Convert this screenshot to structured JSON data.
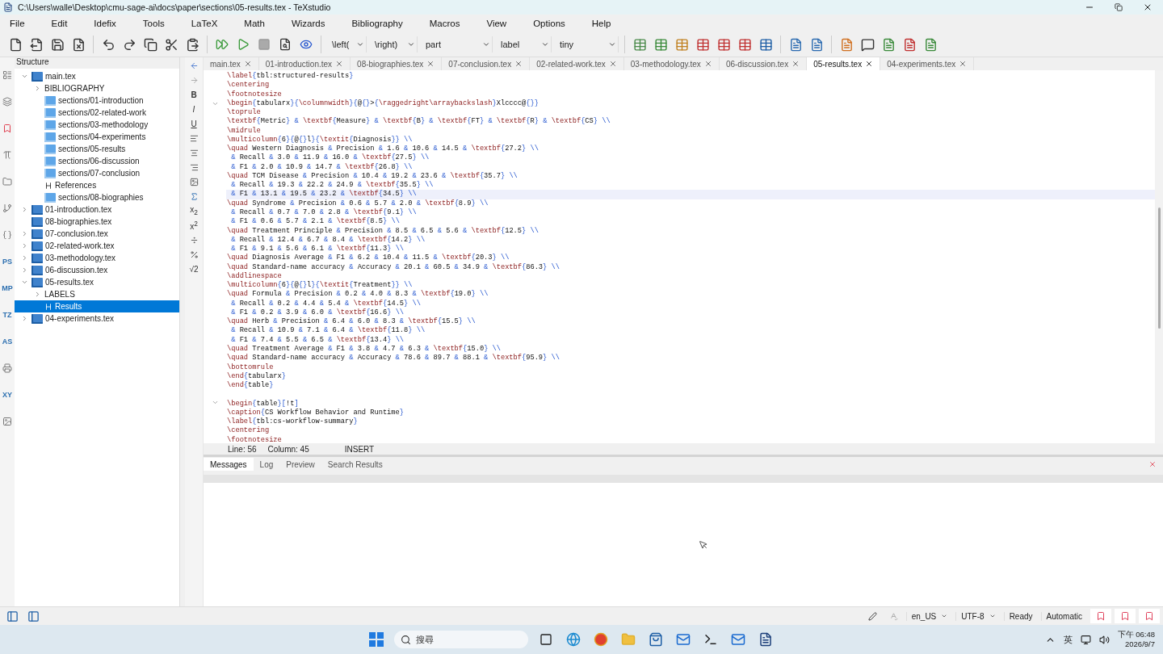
{
  "window": {
    "title": "C:\\Users\\walle\\Desktop\\cmu-sage-ai\\docs\\paper\\sections\\05-results.tex - TeXstudio"
  },
  "menu": [
    "File",
    "Edit",
    "Idefix",
    "Tools",
    "LaTeX",
    "Math",
    "Wizards",
    "Bibliography",
    "Macros",
    "View",
    "Options",
    "Help"
  ],
  "toolbar_combos": [
    {
      "value": "\\left("
    },
    {
      "value": "\\right)"
    },
    {
      "value": "part"
    },
    {
      "value": "label"
    },
    {
      "value": "tiny"
    }
  ],
  "side_tabs": [
    {
      "kind": "icon"
    },
    {
      "kind": "icon"
    },
    {
      "kind": "icon"
    },
    {
      "kind": "icon"
    },
    {
      "kind": "icon"
    },
    {
      "kind": "icon"
    },
    {
      "kind": "icon"
    },
    {
      "kind": "text",
      "label": "PS"
    },
    {
      "kind": "text",
      "label": "MP"
    },
    {
      "kind": "text",
      "label": "TZ"
    },
    {
      "kind": "text",
      "label": "AS"
    },
    {
      "kind": "icon"
    },
    {
      "kind": "text",
      "label": "XY"
    },
    {
      "kind": "icon"
    }
  ],
  "structure": {
    "title": "Structure",
    "items": [
      {
        "label": "main.tex",
        "kind": "file",
        "expanded": true,
        "selected": false,
        "children": [
          {
            "label": "BIBLIOGRAPHY",
            "kind": "group",
            "expanded": false,
            "selected": false
          },
          {
            "label": "sections/01-introduction",
            "kind": "include",
            "selected": false
          },
          {
            "label": "sections/02-related-work",
            "kind": "include",
            "selected": false
          },
          {
            "label": "sections/03-methodology",
            "kind": "include",
            "selected": false
          },
          {
            "label": "sections/04-experiments",
            "kind": "include",
            "selected": false
          },
          {
            "label": "sections/05-results",
            "kind": "include",
            "selected": false
          },
          {
            "label": "sections/06-discussion",
            "kind": "include",
            "selected": false
          },
          {
            "label": "sections/07-conclusion",
            "kind": "include",
            "selected": false
          },
          {
            "label": "References",
            "kind": "section",
            "selected": false
          },
          {
            "label": "sections/08-biographies",
            "kind": "include",
            "selected": false
          }
        ]
      },
      {
        "label": "01-introduction.tex",
        "kind": "file",
        "expanded": false,
        "selected": false
      },
      {
        "label": "08-biographies.tex",
        "kind": "file",
        "selected": false
      },
      {
        "label": "07-conclusion.tex",
        "kind": "file",
        "expanded": false,
        "selected": false
      },
      {
        "label": "02-related-work.tex",
        "kind": "file",
        "expanded": false,
        "selected": false
      },
      {
        "label": "03-methodology.tex",
        "kind": "file",
        "expanded": false,
        "selected": false
      },
      {
        "label": "06-discussion.tex",
        "kind": "file",
        "expanded": false,
        "selected": false
      },
      {
        "label": "05-results.tex",
        "kind": "file",
        "expanded": true,
        "selected": false,
        "children": [
          {
            "label": "LABELS",
            "kind": "group",
            "expanded": false,
            "selected": false
          },
          {
            "label": "Results",
            "kind": "section",
            "selected": true
          }
        ]
      },
      {
        "label": "04-experiments.tex",
        "kind": "file",
        "expanded": false,
        "selected": false
      }
    ]
  },
  "format_buttons": [
    {
      "kind": "text",
      "label": "B"
    },
    {
      "kind": "text",
      "label": "I"
    },
    {
      "kind": "text",
      "label": "U"
    },
    {
      "kind": "icon"
    },
    {
      "kind": "icon"
    },
    {
      "kind": "icon"
    },
    {
      "kind": "icon"
    },
    {
      "kind": "icon"
    },
    {
      "kind": "text",
      "label": "x$_{2}$"
    },
    {
      "kind": "text",
      "label": "x$^{2}$"
    },
    {
      "kind": "icon"
    },
    {
      "kind": "icon"
    },
    {
      "kind": "text",
      "label": "√2"
    }
  ],
  "tabs": [
    {
      "label": "main.tex",
      "selected": false
    },
    {
      "label": "01-introduction.tex",
      "selected": false
    },
    {
      "label": "08-biographies.tex",
      "selected": false
    },
    {
      "label": "07-conclusion.tex",
      "selected": false
    },
    {
      "label": "02-related-work.tex",
      "selected": false
    },
    {
      "label": "03-methodology.tex",
      "selected": false
    },
    {
      "label": "06-discussion.tex",
      "selected": false
    },
    {
      "label": "05-results.tex",
      "selected": true
    },
    {
      "label": "04-experiments.tex",
      "selected": false
    }
  ],
  "editor": {
    "lines": [
      {
        "text": "\\label{tbl:structured-results}",
        "current": false,
        "fold": false
      },
      {
        "text": "\\centering",
        "current": false,
        "fold": false
      },
      {
        "text": "\\footnotesize",
        "current": false,
        "fold": false
      },
      {
        "text": "\\begin{tabularx}{\\columnwidth}{@{}>{\\raggedright\\arraybackslash}Xlcccc@{}}",
        "current": false,
        "fold": true
      },
      {
        "text": "\\toprule",
        "current": false,
        "fold": false
      },
      {
        "text": "\\textbf{Metric} & \\textbf{Measure} & \\textbf{B} & \\textbf{FT} & \\textbf{R} & \\textbf{CS} \\\\",
        "current": false,
        "fold": false
      },
      {
        "text": "\\midrule",
        "current": false,
        "fold": false
      },
      {
        "text": "\\multicolumn{6}{@{}l}{\\textit{Diagnosis}} \\\\",
        "current": false,
        "fold": false
      },
      {
        "text": "\\quad Western Diagnosis & Precision & 1.6 & 10.6 & 14.5 & \\textbf{27.2} \\\\",
        "current": false,
        "fold": false
      },
      {
        "text": " & Recall & 3.0 & 11.9 & 16.0 & \\textbf{27.5} \\\\",
        "current": false,
        "fold": false
      },
      {
        "text": " & F1 & 2.0 & 10.9 & 14.7 & \\textbf{26.8} \\\\",
        "current": false,
        "fold": false
      },
      {
        "text": "\\quad TCM Disease & Precision & 10.4 & 19.2 & 23.6 & \\textbf{35.7} \\\\",
        "current": false,
        "fold": false
      },
      {
        "text": " & Recall & 19.3 & 22.2 & 24.9 & \\textbf{35.5} \\\\",
        "current": false,
        "fold": false
      },
      {
        "text": " & F1 & 13.1 & 19.5 & 23.2 & \\textbf{34.5} \\\\",
        "current": true,
        "fold": false
      },
      {
        "text": "\\quad Syndrome & Precision & 0.6 & 5.7 & 2.0 & \\textbf{8.9} \\\\",
        "current": false,
        "fold": false
      },
      {
        "text": " & Recall & 0.7 & 7.0 & 2.8 & \\textbf{9.1} \\\\",
        "current": false,
        "fold": false
      },
      {
        "text": " & F1 & 0.6 & 5.7 & 2.1 & \\textbf{8.5} \\\\",
        "current": false,
        "fold": false
      },
      {
        "text": "\\quad Treatment Principle & Precision & 8.5 & 6.5 & 5.6 & \\textbf{12.5} \\\\",
        "current": false,
        "fold": false
      },
      {
        "text": " & Recall & 12.4 & 6.7 & 8.4 & \\textbf{14.2} \\\\",
        "current": false,
        "fold": false
      },
      {
        "text": " & F1 & 9.1 & 5.6 & 6.1 & \\textbf{11.3} \\\\",
        "current": false,
        "fold": false
      },
      {
        "text": "\\quad Diagnosis Average & F1 & 6.2 & 10.4 & 11.5 & \\textbf{20.3} \\\\",
        "current": false,
        "fold": false
      },
      {
        "text": "\\quad Standard-name accuracy & Accuracy & 20.1 & 60.5 & 34.9 & \\textbf{86.3} \\\\",
        "current": false,
        "fold": false
      },
      {
        "text": "\\addlinespace",
        "current": false,
        "fold": false
      },
      {
        "text": "\\multicolumn{6}{@{}l}{\\textit{Treatment}} \\\\",
        "current": false,
        "fold": false
      },
      {
        "text": "\\quad Formula & Precision & 0.2 & 4.0 & 8.3 & \\textbf{19.0} \\\\",
        "current": false,
        "fold": false
      },
      {
        "text": " & Recall & 0.2 & 4.4 & 5.4 & \\textbf{14.5} \\\\",
        "current": false,
        "fold": false
      },
      {
        "text": " & F1 & 0.2 & 3.9 & 6.0 & \\textbf{16.6} \\\\",
        "current": false,
        "fold": false
      },
      {
        "text": "\\quad Herb & Precision & 6.4 & 6.0 & 8.3 & \\textbf{15.5} \\\\",
        "current": false,
        "fold": false
      },
      {
        "text": " & Recall & 10.9 & 7.1 & 6.4 & \\textbf{11.8} \\\\",
        "current": false,
        "fold": false
      },
      {
        "text": " & F1 & 7.4 & 5.5 & 6.5 & \\textbf{13.4} \\\\",
        "current": false,
        "fold": false
      },
      {
        "text": "\\quad Treatment Average & F1 & 3.8 & 4.7 & 6.3 & \\textbf{15.0} \\\\",
        "current": false,
        "fold": false
      },
      {
        "text": "\\quad Standard-name accuracy & Accuracy & 78.6 & 89.7 & 88.1 & \\textbf{95.9} \\\\",
        "current": false,
        "fold": false
      },
      {
        "text": "\\bottomrule",
        "current": false,
        "fold": false
      },
      {
        "text": "\\end{tabularx}",
        "current": false,
        "fold": false
      },
      {
        "text": "\\end{table}",
        "current": false,
        "fold": false
      },
      {
        "kind": "blank"
      },
      {
        "text": "\\begin{table}[!t]",
        "current": false,
        "fold": true
      },
      {
        "text": "\\caption{CS Workflow Behavior and Runtime}",
        "current": false,
        "fold": false
      },
      {
        "text": "\\label{tbl:cs-workflow-summary}",
        "current": false,
        "fold": false
      },
      {
        "text": "\\centering",
        "current": false,
        "fold": false
      },
      {
        "text": "\\footnotesize",
        "current": false,
        "fold": false
      }
    ],
    "status": {
      "line": "Line: 56",
      "column": "Column: 45",
      "mode": "INSERT"
    }
  },
  "message_tabs": [
    {
      "label": "Messages",
      "selected": true
    },
    {
      "label": "Log",
      "selected": false
    },
    {
      "label": "Preview",
      "selected": false
    },
    {
      "label": "Search Results",
      "selected": false
    }
  ],
  "status_bar": {
    "language": "en_US",
    "encoding": "UTF-8",
    "state": "Ready",
    "mode": "Automatic"
  },
  "taskbar": {
    "search_placeholder": "搜尋",
    "ime": "英",
    "time": "下午 06:48",
    "date": "2026/9/7"
  }
}
